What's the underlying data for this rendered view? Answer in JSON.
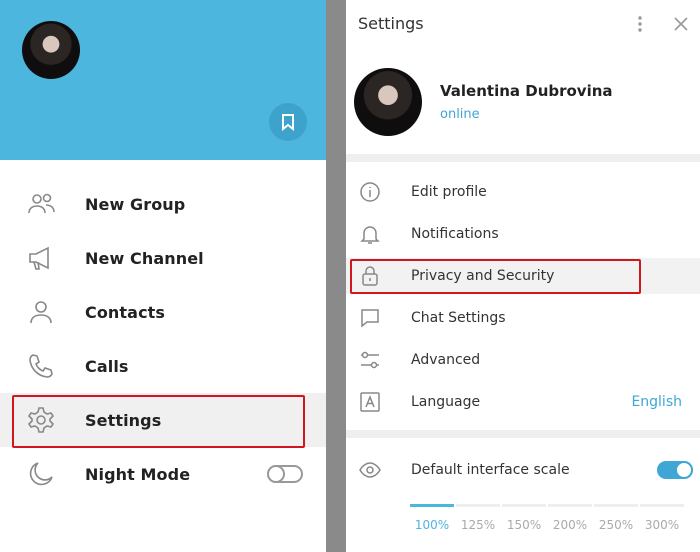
{
  "menu": {
    "items": [
      {
        "label": "New Group",
        "icon": "group-icon"
      },
      {
        "label": "New Channel",
        "icon": "megaphone-icon"
      },
      {
        "label": "Contacts",
        "icon": "person-icon"
      },
      {
        "label": "Calls",
        "icon": "phone-icon"
      },
      {
        "label": "Settings",
        "icon": "gear-icon"
      },
      {
        "label": "Night Mode",
        "icon": "moon-icon"
      }
    ],
    "night_mode": false
  },
  "settings": {
    "title": "Settings",
    "profile": {
      "name": "Valentina Dubrovina",
      "status": "online"
    },
    "items": [
      {
        "label": "Edit profile",
        "icon": "info-icon"
      },
      {
        "label": "Notifications",
        "icon": "bell-icon"
      },
      {
        "label": "Privacy and Security",
        "icon": "lock-icon"
      },
      {
        "label": "Chat Settings",
        "icon": "chat-icon"
      },
      {
        "label": "Advanced",
        "icon": "sliders-icon"
      },
      {
        "label": "Language",
        "icon": "language-icon",
        "value": "English"
      }
    ],
    "scale": {
      "label": "Default interface scale",
      "enabled": true,
      "options": [
        "100%",
        "125%",
        "150%",
        "200%",
        "250%",
        "300%"
      ],
      "selected": "100%"
    }
  },
  "colors": {
    "accent": "#4db6de",
    "highlight": "#d0161f"
  }
}
